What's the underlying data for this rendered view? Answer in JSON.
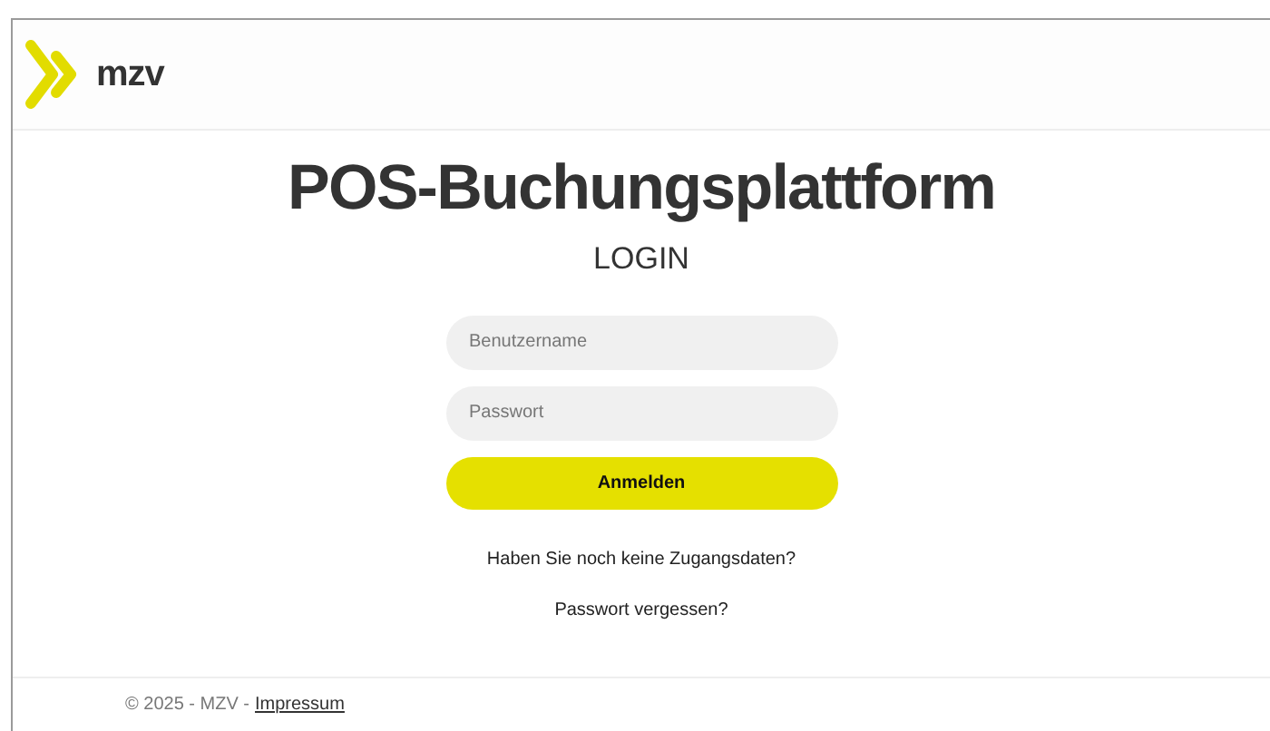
{
  "header": {
    "brand": "mzv"
  },
  "title": "POS-Buchungsplattform",
  "subtitle": "LOGIN",
  "form": {
    "username": {
      "placeholder": "Benutzername"
    },
    "password": {
      "placeholder": "Passwort"
    },
    "submit": "Anmelden"
  },
  "links": [
    "Haben Sie noch keine Zugangsdaten?",
    "Passwort vergessen?"
  ],
  "footer": {
    "copyright": "© 2025 - MZV -",
    "link": "Impressum"
  }
}
